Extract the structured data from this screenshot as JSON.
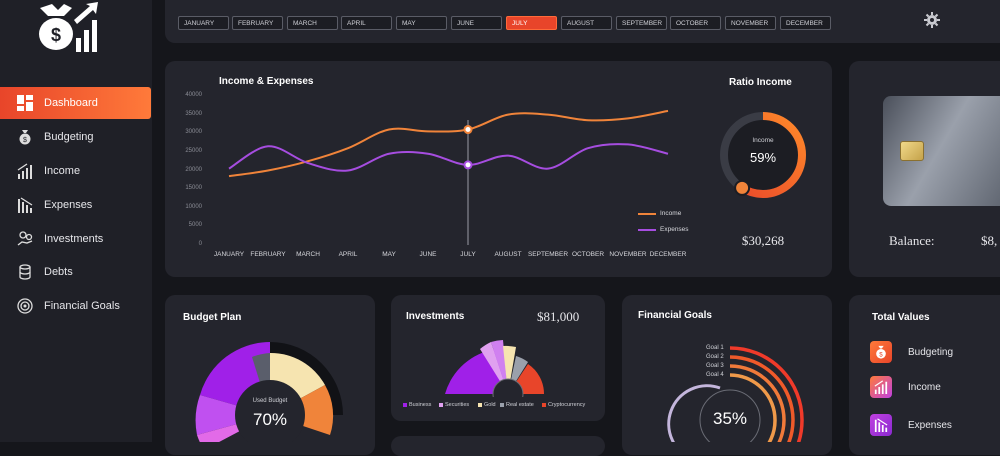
{
  "sidebar": {
    "items": [
      {
        "label": "Dashboard",
        "icon": "dashboard-icon",
        "active": true
      },
      {
        "label": "Budgeting",
        "icon": "money-bag-icon"
      },
      {
        "label": "Income",
        "icon": "bar-chart-up-icon"
      },
      {
        "label": "Expenses",
        "icon": "bar-chart-down-icon"
      },
      {
        "label": "Investments",
        "icon": "hand-coins-icon"
      },
      {
        "label": "Debts",
        "icon": "coins-stack-icon"
      },
      {
        "label": "Financial Goals",
        "icon": "target-icon"
      }
    ]
  },
  "months": [
    "JANUARY",
    "FEBRUARY",
    "MARCH",
    "APRIL",
    "MAY",
    "JUNE",
    "JULY",
    "AUGUST",
    "SEPTEMBER",
    "OCTOBER",
    "NOVEMBER",
    "DECEMBER"
  ],
  "selected_month": "JULY",
  "income_expenses": {
    "title": "Income & Expenses"
  },
  "ratio_income": {
    "title": "Ratio Income",
    "center_label": "Income",
    "percent": "59%",
    "fraction": 0.59,
    "amount": "$30,268"
  },
  "balance": {
    "label": "Balance:",
    "value": "$8,"
  },
  "budget_plan": {
    "title": "Budget Plan",
    "center_label": "Used Budget",
    "percent": "70%"
  },
  "investments": {
    "title": "Investments",
    "amount": "$81,000",
    "legend": [
      "Business",
      "Securities",
      "Gold",
      "Real estate",
      "Cryptocurrency"
    ]
  },
  "financial_goals": {
    "title": "Financial Goals",
    "goals": [
      "Goal 1",
      "Goal 2",
      "Goal 3",
      "Goal 4"
    ],
    "percent": "35%"
  },
  "total_values": {
    "title": "Total Values",
    "items": [
      "Budgeting",
      "Income",
      "Expenses"
    ]
  },
  "colors": {
    "accent": "#e8452a",
    "income": "#f0843a",
    "expenses": "#a64de0",
    "card": "#24252d",
    "background": "#15161b"
  },
  "chart_data": {
    "type": "line",
    "title": "Income & Expenses",
    "categories": [
      "JANUARY",
      "FEBRUARY",
      "MARCH",
      "APRIL",
      "MAY",
      "JUNE",
      "JULY",
      "AUGUST",
      "SEPTEMBER",
      "OCTOBER",
      "NOVEMBER",
      "DECEMBER"
    ],
    "y_ticks": [
      "40000",
      "35000",
      "30000",
      "25000",
      "20000",
      "15000",
      "10000",
      "5000",
      "0"
    ],
    "ylim": [
      0,
      40000
    ],
    "series": [
      {
        "name": "Income",
        "color": "#f0843a",
        "values": [
          18500,
          20000,
          22500,
          26000,
          31000,
          30500,
          31000,
          35000,
          35000,
          33500,
          34000,
          36000
        ]
      },
      {
        "name": "Expenses",
        "color": "#a64de0",
        "values": [
          20500,
          26500,
          22000,
          20000,
          24500,
          24500,
          21500,
          24000,
          20500,
          26000,
          27000,
          24500
        ]
      }
    ],
    "highlight": "JULY",
    "legend_position": "bottom-right",
    "grid": false
  }
}
